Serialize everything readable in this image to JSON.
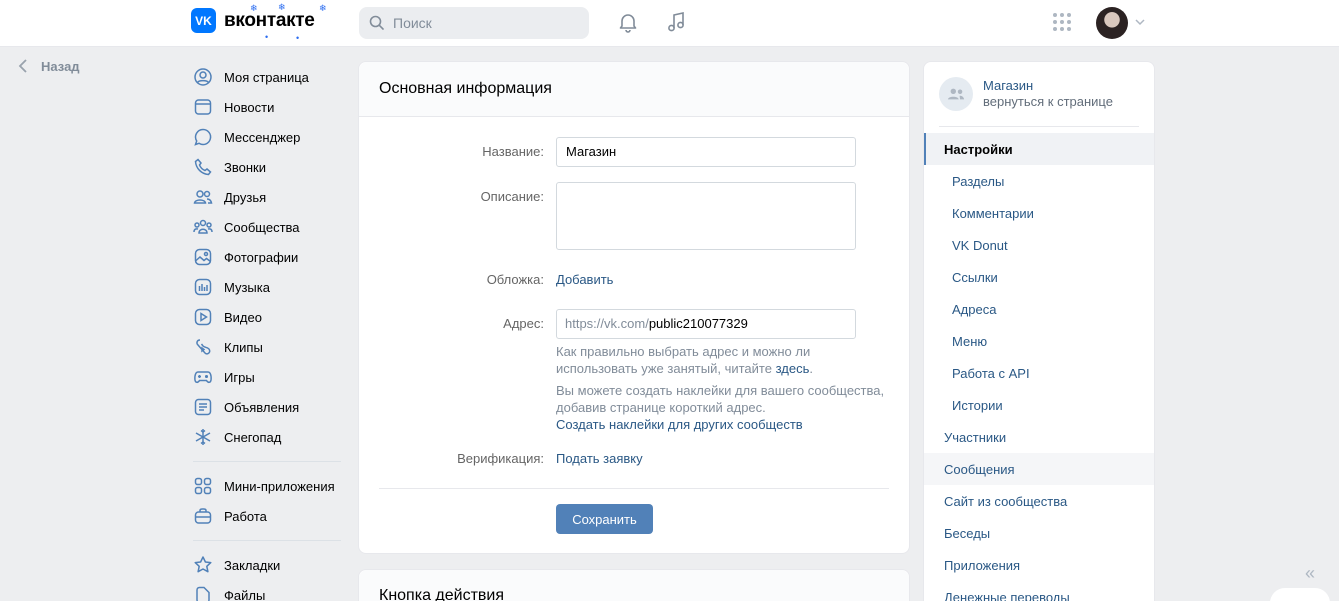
{
  "header": {
    "logo_mark": "VK",
    "logo_text": "вконтакте",
    "search_placeholder": "Поиск",
    "icons": [
      "search-icon",
      "bell-icon",
      "music-icon",
      "apps-grid-icon",
      "chevron-down-icon"
    ]
  },
  "back": {
    "label": "Назад"
  },
  "nav": {
    "items": [
      {
        "label": "Моя страница",
        "icon": "user-circle-icon"
      },
      {
        "label": "Новости",
        "icon": "news-icon"
      },
      {
        "label": "Мессенджер",
        "icon": "message-icon"
      },
      {
        "label": "Звонки",
        "icon": "phone-icon"
      },
      {
        "label": "Друзья",
        "icon": "friends-icon"
      },
      {
        "label": "Сообщества",
        "icon": "communities-icon"
      },
      {
        "label": "Фотографии",
        "icon": "photo-icon"
      },
      {
        "label": "Музыка",
        "icon": "music-icon"
      },
      {
        "label": "Видео",
        "icon": "video-icon"
      },
      {
        "label": "Клипы",
        "icon": "clips-icon"
      },
      {
        "label": "Игры",
        "icon": "gamepad-icon"
      },
      {
        "label": "Объявления",
        "icon": "ads-icon"
      },
      {
        "label": "Снегопад",
        "icon": "snowflake-icon"
      }
    ],
    "items2": [
      {
        "label": "Мини-приложения",
        "icon": "mini-apps-icon"
      },
      {
        "label": "Работа",
        "icon": "briefcase-icon"
      }
    ],
    "items3": [
      {
        "label": "Закладки",
        "icon": "star-icon"
      },
      {
        "label": "Файлы",
        "icon": "file-icon"
      }
    ]
  },
  "main": {
    "title": "Основная информация",
    "name_label": "Название:",
    "name_value": "Магазин",
    "desc_label": "Описание:",
    "cover_label": "Обложка:",
    "cover_link": "Добавить",
    "address_label": "Адрес:",
    "address_prefix": "https://vk.com/",
    "address_value": "public210077329",
    "hint1_a": "Как правильно выбрать адрес и можно ли использовать уже занятый, читайте",
    "hint1_link": "здесь",
    "hint1_end": ".",
    "hint2": "Вы можете создать наклейки для вашего сообщества, добавив странице короткий адрес.",
    "hint2_link": "Создать наклейки для других сообществ",
    "verify_label": "Верификация:",
    "verify_link": "Подать заявку",
    "save_label": "Сохранить"
  },
  "card2": {
    "title": "Кнопка действия"
  },
  "right": {
    "name": "Магазин",
    "back_text": "вернуться к странице",
    "items": [
      {
        "label": "Настройки",
        "state": "active"
      },
      {
        "label": "Разделы",
        "state": "sub"
      },
      {
        "label": "Комментарии",
        "state": "sub"
      },
      {
        "label": "VK Donut",
        "state": "sub"
      },
      {
        "label": "Ссылки",
        "state": "sub"
      },
      {
        "label": "Адреса",
        "state": "sub"
      },
      {
        "label": "Меню",
        "state": "sub"
      },
      {
        "label": "Работа с API",
        "state": "sub"
      },
      {
        "label": "Истории",
        "state": "sub"
      },
      {
        "label": "Участники",
        "state": ""
      },
      {
        "label": "Сообщения",
        "state": "hover"
      },
      {
        "label": "Сайт из сообщества",
        "state": ""
      },
      {
        "label": "Беседы",
        "state": ""
      },
      {
        "label": "Приложения",
        "state": ""
      },
      {
        "label": "Денежные переводы",
        "state": ""
      }
    ]
  },
  "colors": {
    "accent": "#5181b8",
    "link": "#2a5885",
    "brand": "#0077ff",
    "bg": "#edeef0"
  }
}
